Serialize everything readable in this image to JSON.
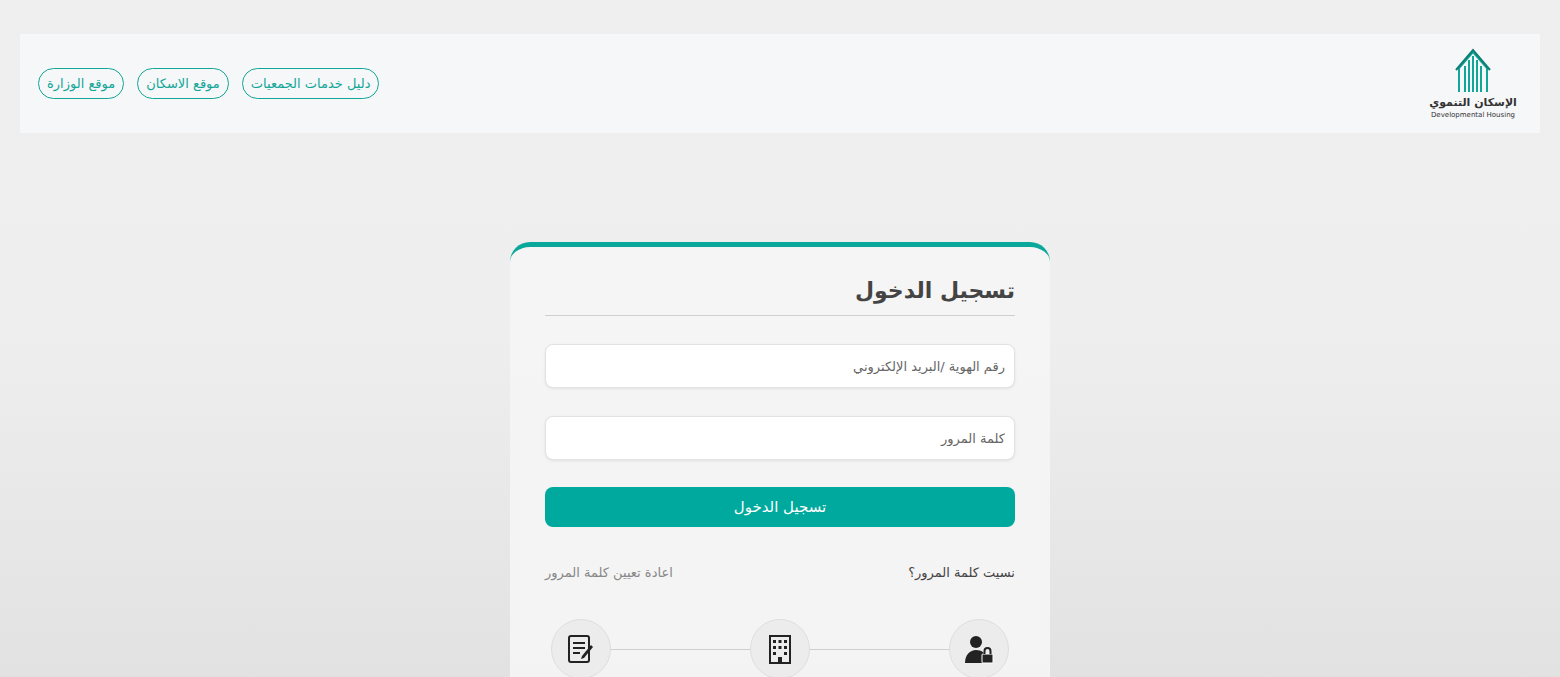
{
  "logo": {
    "title": "الإسكان التنموي",
    "subtitle": "Developmental Housing"
  },
  "nav_links": [
    "دليل خدمات الجمعيات",
    "موقع الاسكان",
    "موقع الوزارة"
  ],
  "login": {
    "title": "تسجيل الدخول",
    "fields": [
      {
        "placeholder": "رقم الهوية /البريد الإلكتروني"
      },
      {
        "placeholder": "كلمة المرور"
      }
    ],
    "submit": "تسجيل الدخول",
    "forgot": "نسيت كلمة المرور؟",
    "reset": "اعادة تعيين كلمة المرور"
  }
}
